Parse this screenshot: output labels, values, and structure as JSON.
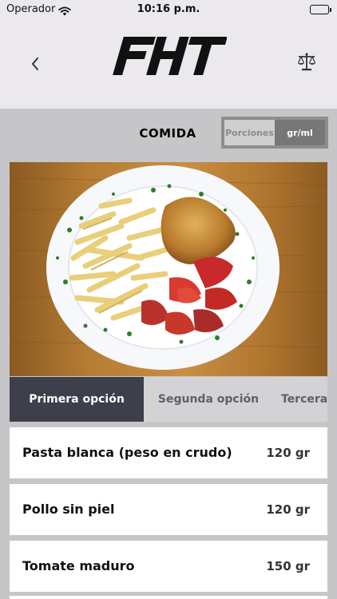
{
  "status_bar": {
    "carrier": "Operador",
    "time": "10:16 p.m."
  },
  "header": {
    "logo_text": "FHT",
    "meal_title": "COMIDA"
  },
  "unit_toggle": {
    "options": [
      "Porciones",
      "gr/ml"
    ],
    "selected": "gr/ml"
  },
  "tabs": [
    {
      "label": "Primera opción",
      "active": true
    },
    {
      "label": "Segunda opción",
      "active": false
    },
    {
      "label": "Tercera",
      "active": false
    }
  ],
  "foods": [
    {
      "name": "Pasta blanca (peso en crudo)",
      "quantity": "120 gr"
    },
    {
      "name": "Pollo sin piel",
      "quantity": "120 gr"
    },
    {
      "name": "Tomate maduro",
      "quantity": "150 gr"
    }
  ],
  "icons": {
    "back": "chevron-left-icon",
    "scale": "balance-scale-icon",
    "wifi": "wifi-icon",
    "battery": "battery-icon"
  },
  "colors": {
    "active_tab_bg": "#3d3f4a",
    "toggle_selected_bg": "#777779",
    "nav_bg": "#ebe9ed",
    "page_bg": "#c6c6c8"
  }
}
